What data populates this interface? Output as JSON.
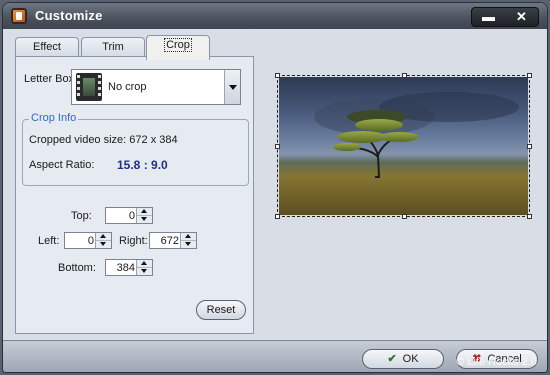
{
  "window": {
    "title": "Customize",
    "minimize": "▬",
    "close": "✕"
  },
  "tabs": [
    {
      "label": "Effect"
    },
    {
      "label": "Trim"
    },
    {
      "label": "Crop"
    }
  ],
  "crop": {
    "letterbox_label": "Letter Box:",
    "letterbox_value": "No crop",
    "crop_info_title": "Crop Info",
    "cropped_size": "Cropped video size: 672 x 384",
    "aspect_label": "Aspect Ratio:",
    "aspect_value": "15.8 : 9.0",
    "top_label": "Top:",
    "top_value": "0",
    "left_label": "Left:",
    "left_value": "0",
    "right_label": "Right:",
    "right_value": "672",
    "bottom_label": "Bottom:",
    "bottom_value": "384",
    "reset_label": "Reset"
  },
  "footer": {
    "ok_label": "OK",
    "cancel_label": "Cancel"
  },
  "watermark": "© Life Rocks 2.0",
  "icons": [
    "app-icon",
    "film-icon",
    "dropdown-arrow-icon",
    "spin-up-icon",
    "spin-down-icon",
    "check-icon",
    "cancel-x-icon"
  ]
}
